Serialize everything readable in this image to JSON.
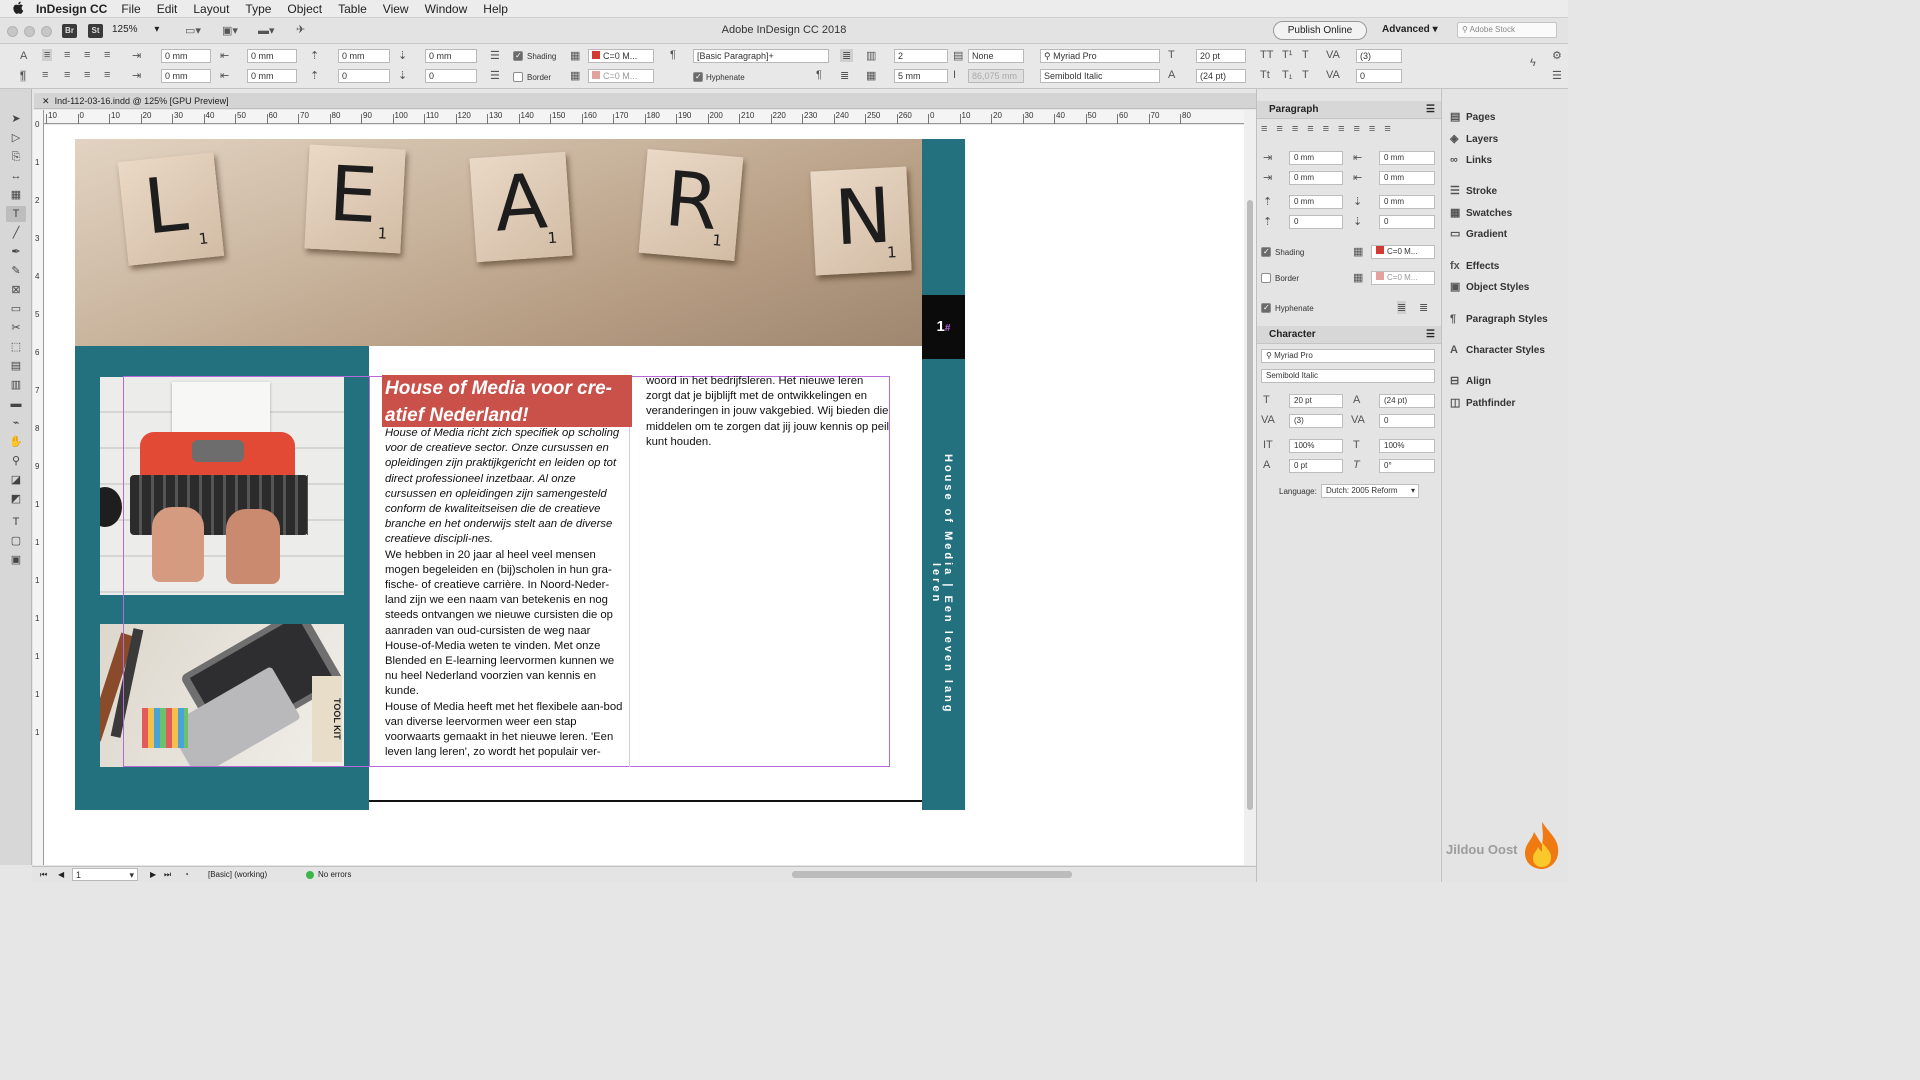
{
  "menubar": {
    "app": "InDesign CC",
    "items": [
      "File",
      "Edit",
      "Layout",
      "Type",
      "Object",
      "Table",
      "View",
      "Window",
      "Help"
    ]
  },
  "titlebar": {
    "title": "Adobe InDesign CC 2018",
    "zoom": "125%",
    "br": "Br",
    "st": "St",
    "publish": "Publish Online",
    "workspace": "Advanced",
    "stock_placeholder": "Adobe Stock"
  },
  "control": {
    "mm": "0 mm",
    "zero": "0",
    "shading_label": "Shading",
    "shading_color": "C=0 M...",
    "border_label": "Border",
    "border_color": "C=0 M...",
    "para_style": "[Basic Paragraph]+",
    "hyphenate_label": "Hyphenate",
    "columns": "2",
    "gutter": "5 mm",
    "none": "None",
    "span_width": "86,075 mm",
    "font": "Myriad Pro",
    "style": "Semibold Italic",
    "size": "20 pt",
    "leading": "(24 pt)",
    "kerning": "(3)",
    "tracking": "0"
  },
  "document": {
    "tab": "Ind-112-03-16.indd @ 125% [GPU Preview]"
  },
  "ruler": {
    "h": [
      "10",
      "0",
      "10",
      "20",
      "30",
      "40",
      "50",
      "60",
      "70",
      "80",
      "90",
      "100",
      "110",
      "120",
      "130",
      "140",
      "150",
      "160",
      "170",
      "180",
      "190",
      "200",
      "210",
      "220",
      "230",
      "240",
      "250",
      "260",
      "0",
      "10",
      "20",
      "30",
      "40",
      "50",
      "60",
      "70",
      "80"
    ],
    "v": [
      "0",
      "1",
      "2",
      "3",
      "4",
      "5",
      "6",
      "7",
      "8",
      "9",
      "1",
      "1",
      "1",
      "1",
      "1",
      "1",
      "1"
    ]
  },
  "page": {
    "photo_letters": [
      {
        "l": "L",
        "n": "1"
      },
      {
        "l": "E",
        "n": "1"
      },
      {
        "l": "A",
        "n": "1"
      },
      {
        "l": "R",
        "n": "1"
      },
      {
        "l": "N",
        "n": "1"
      }
    ],
    "page_number": "1",
    "vertical_title": "House of Media | Een leven lang leren",
    "headline": "House of Media voor cre-atief Nederland!",
    "para1": "House of Media richt zich specifiek op scholing voor de creatieve sector. Onze cursussen en opleidingen zijn praktijkgericht en leiden op tot direct professioneel inzetbaar. Al onze cursussen en opleidingen zijn samengesteld conform de kwaliteitseisen die de creatieve branche en het onderwijs stelt aan de diverse creatieve discipli-nes.",
    "para2": "We hebben in 20 jaar al heel veel mensen mogen begeleiden en (bij)scholen in hun gra-fische- of creatieve carrière. In Noord-Neder-land zijn we een naam van betekenis en nog steeds ontvangen we nieuwe cursisten die op aanraden van oud-cursisten de weg naar House-of-Media weten te vinden. Met onze Blended en E-learning leervormen kunnen we nu heel Nederland voorzien van kennis en kunde.",
    "para3": "House of Media heeft met het flexibele aan-bod van diverse leervormen weer een stap voorwaarts gemaakt in het nieuwe leren. 'Een leven lang leren', zo wordt het populair ver-",
    "para4": "woord in het bedrijfsleren. Het nieuwe leren zorgt dat je bijblijft met de ontwikkelingen en veranderingen in jouw vakgebied. Wij bieden die middelen om te zorgen dat jij jouw kennis op peil kunt houden.",
    "toolkit": "TOOL KIT"
  },
  "paragraph_panel": {
    "title": "Paragraph",
    "mm": "0 mm",
    "zero": "0",
    "shading": "Shading",
    "border": "Border",
    "color": "C=0 M...",
    "hyphenate": "Hyphenate"
  },
  "character_panel": {
    "title": "Character",
    "font": "Myriad Pro",
    "style": "Semibold Italic",
    "size": "20 pt",
    "leading": "(24 pt)",
    "kerning": "(3)",
    "tracking": "0",
    "vscale": "100%",
    "hscale": "100%",
    "baseline": "0 pt",
    "skew": "0°",
    "language_label": "Language:",
    "language": "Dutch: 2005 Reform"
  },
  "dock": {
    "items": [
      {
        "label": "Pages",
        "icon": "pages-icon",
        "glyph": "▤"
      },
      {
        "label": "Layers",
        "icon": "layers-icon",
        "glyph": "◈"
      },
      {
        "label": "Links",
        "icon": "links-icon",
        "glyph": "∞"
      },
      {
        "label": "Stroke",
        "icon": "stroke-icon",
        "glyph": "☰"
      },
      {
        "label": "Swatches",
        "icon": "swatches-icon",
        "glyph": "▦"
      },
      {
        "label": "Gradient",
        "icon": "gradient-icon",
        "glyph": "▭"
      },
      {
        "label": "Effects",
        "icon": "effects-icon",
        "glyph": "fx"
      },
      {
        "label": "Object Styles",
        "icon": "object-styles-icon",
        "glyph": "▣"
      },
      {
        "label": "Paragraph Styles",
        "icon": "paragraph-styles-icon",
        "glyph": "¶"
      },
      {
        "label": "Character Styles",
        "icon": "character-styles-icon",
        "glyph": "A"
      },
      {
        "label": "Align",
        "icon": "align-icon",
        "glyph": "⊟"
      },
      {
        "label": "Pathfinder",
        "icon": "pathfinder-icon",
        "glyph": "◫"
      }
    ],
    "brand": "Jildou Oost"
  },
  "status": {
    "page": "1",
    "style": "[Basic] (working)",
    "errors": "No errors"
  },
  "colors": {
    "teal": "#23707f",
    "headline_red": "#c9514a",
    "frame": "#b56ad8"
  }
}
